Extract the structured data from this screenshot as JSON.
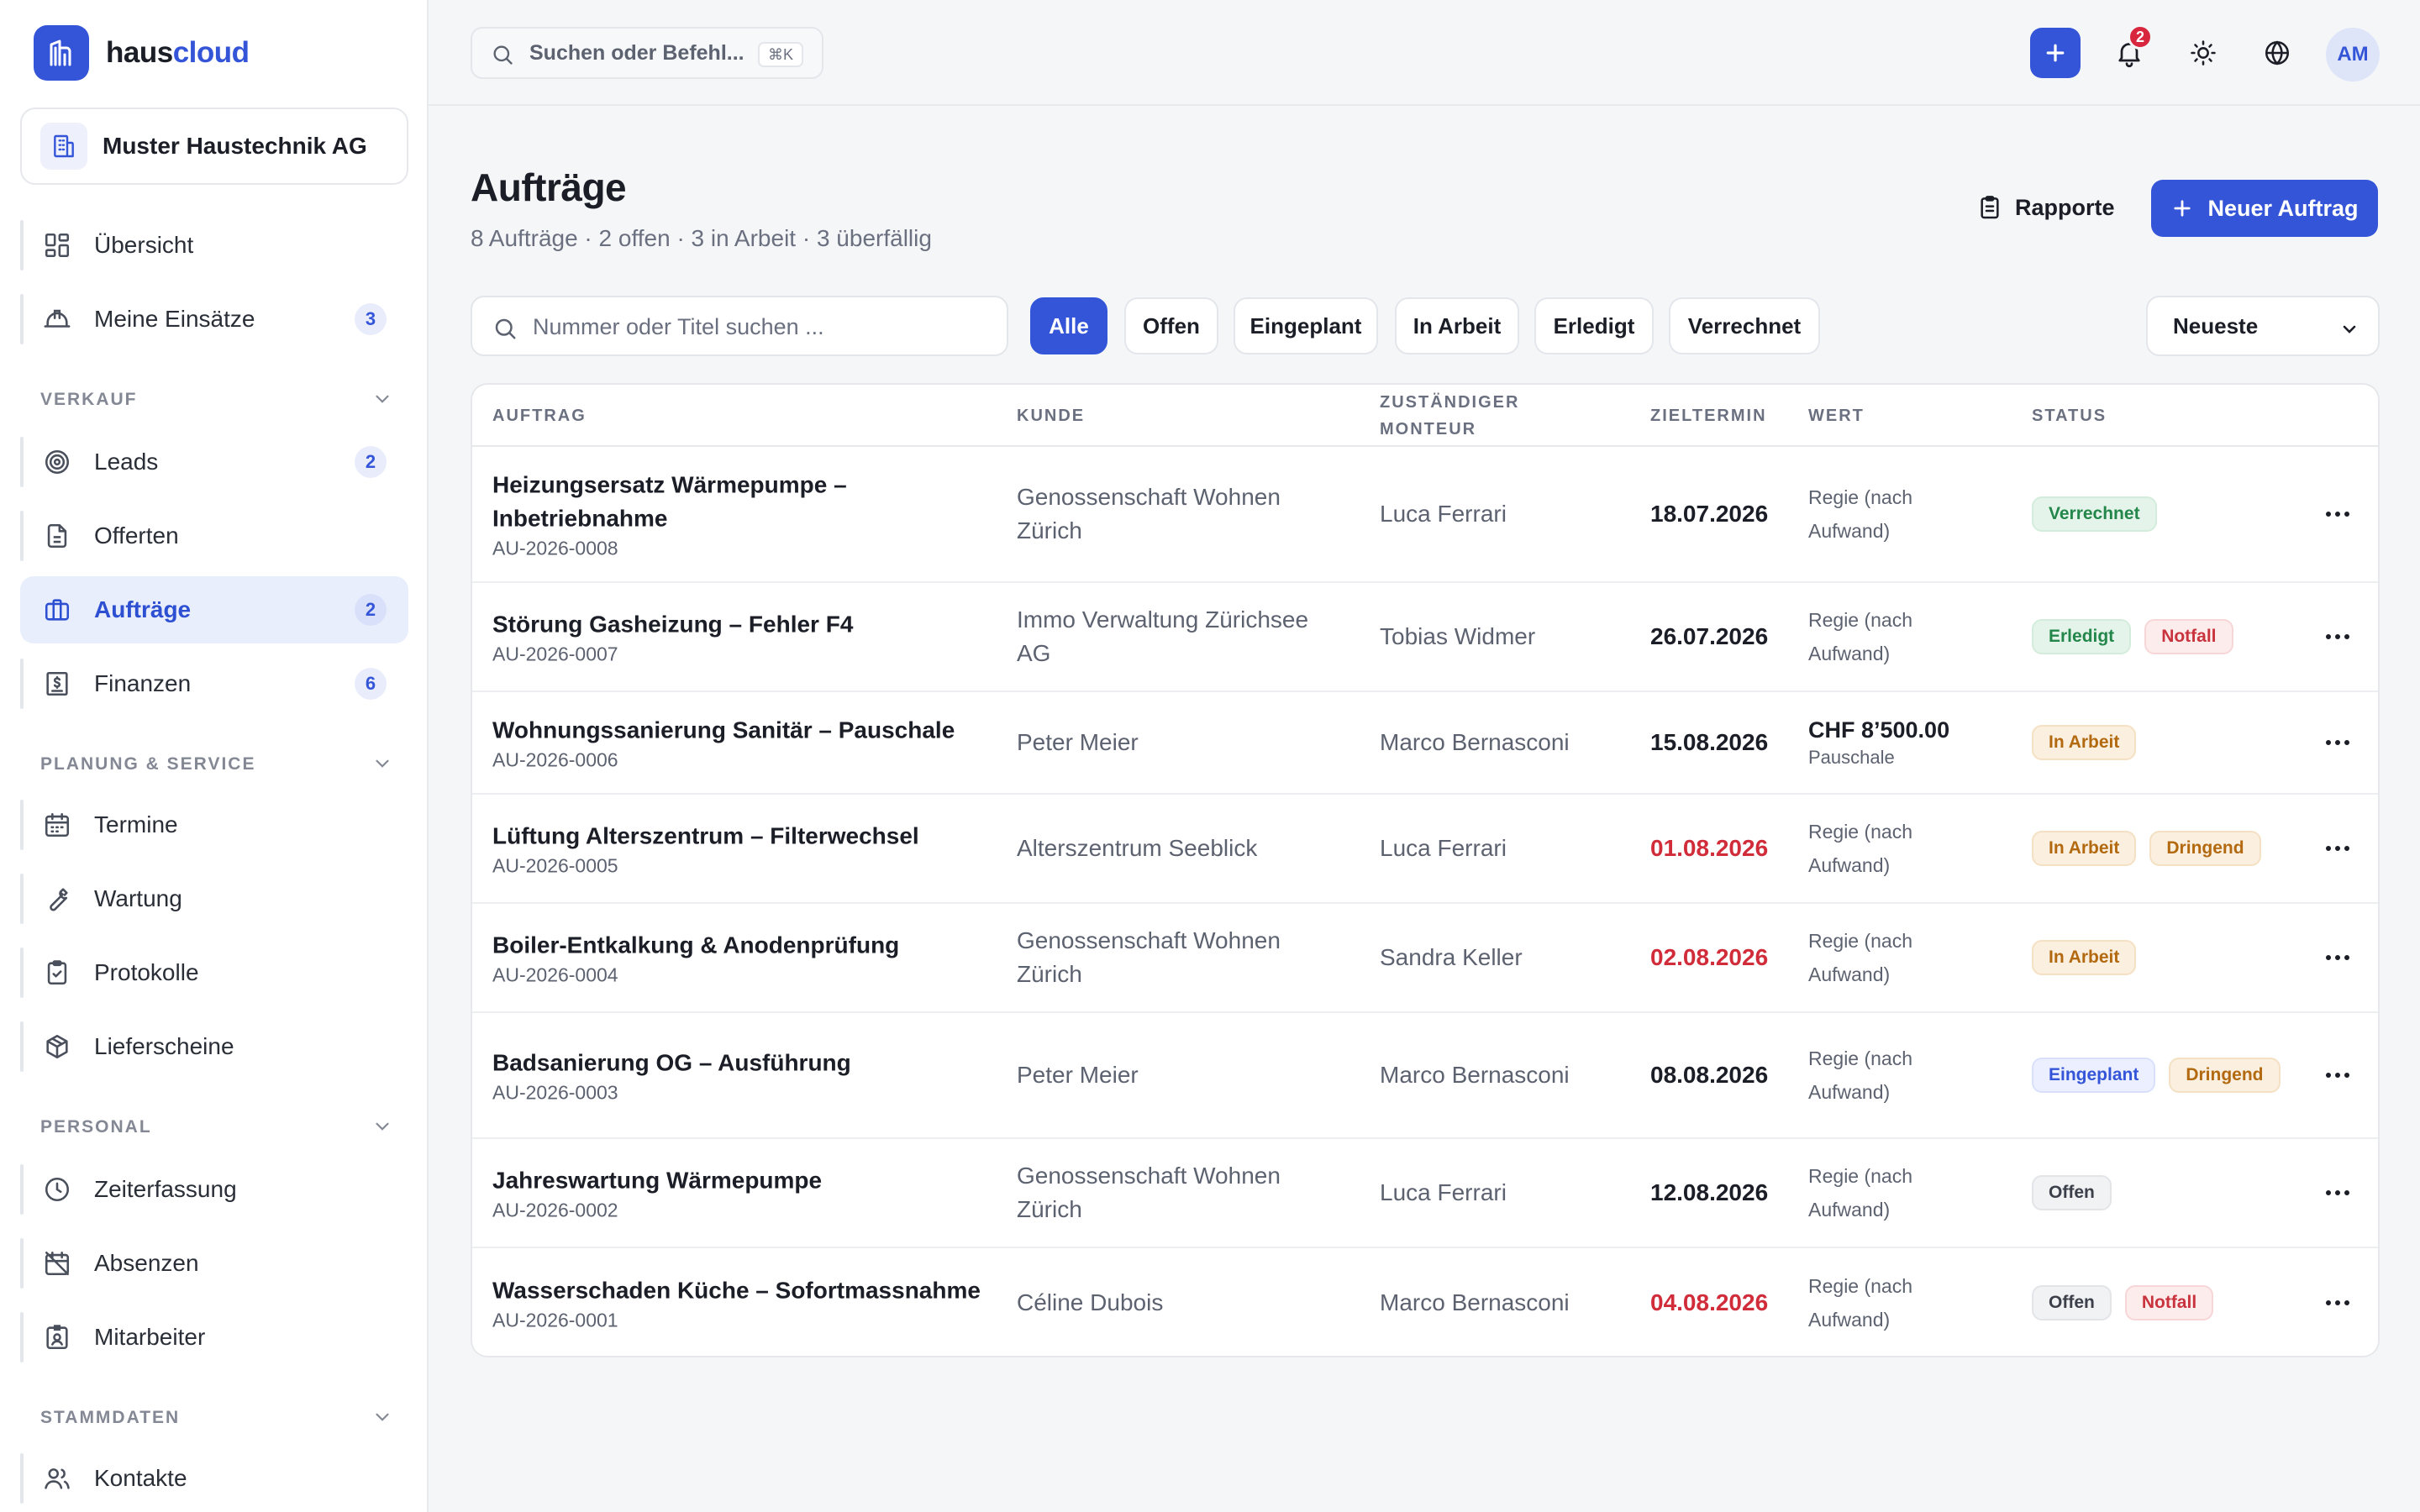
{
  "brand": {
    "part1": "haus",
    "part2": "cloud"
  },
  "company": "Muster Haustechnik AG",
  "nav": {
    "uebersicht": "Übersicht",
    "einsaetze": {
      "label": "Meine Einsätze",
      "count": "3"
    },
    "section_verkauf": "VERKAUF",
    "leads": {
      "label": "Leads",
      "count": "2"
    },
    "offerten": "Offerten",
    "auftraege": {
      "label": "Aufträge",
      "count": "2"
    },
    "finanzen": {
      "label": "Finanzen",
      "count": "6"
    },
    "section_planung": "PLANUNG & SERVICE",
    "termine": "Termine",
    "wartung": "Wartung",
    "protokolle": "Protokolle",
    "lieferscheine": "Lieferscheine",
    "section_personal": "PERSONAL",
    "zeiterfassung": "Zeiterfassung",
    "absenzen": "Absenzen",
    "mitarbeiter": "Mitarbeiter",
    "section_stammdaten": "STAMMDATEN",
    "kontakte": "Kontakte"
  },
  "topbar": {
    "command_placeholder": "Suchen oder Befehl...",
    "shortcut": "⌘K",
    "notifications": "2",
    "avatar": "AM"
  },
  "page": {
    "title": "Aufträge",
    "subtitle": "8 Aufträge · 2 offen · 3 in Arbeit · 3 überfällig",
    "rapporte": "Rapporte",
    "new_order": "Neuer Auftrag"
  },
  "filters": {
    "search_placeholder": "Nummer oder Titel suchen ...",
    "chips": [
      "Alle",
      "Offen",
      "Eingeplant",
      "In Arbeit",
      "Erledigt",
      "Verrechnet"
    ],
    "active_chip": "Alle",
    "sort": "Neueste"
  },
  "table": {
    "headers": {
      "auftrag": "AUFTRAG",
      "kunde": "KUNDE",
      "monteur_1": "ZUSTÄNDIGER",
      "monteur_2": "MONTEUR",
      "zieltermin": "ZIELTERMIN",
      "wert": "WERT",
      "status": "STATUS"
    },
    "rows": [
      {
        "title": "Heizungsersatz Wärmepumpe – Inbetriebnahme",
        "number": "AU-2026-0008",
        "customer": "Genossenschaft Wohnen Zürich",
        "monteur": "Luca Ferrari",
        "date": "18.07.2026",
        "overdue": false,
        "value": "Regie (nach Aufwand)",
        "amount": "",
        "status": [
          {
            "label": "Verrechnet",
            "tone": "green"
          }
        ]
      },
      {
        "title": "Störung Gasheizung – Fehler F4",
        "number": "AU-2026-0007",
        "customer": "Immo Verwaltung Zürichsee AG",
        "monteur": "Tobias Widmer",
        "date": "26.07.2026",
        "overdue": false,
        "value": "Regie (nach Aufwand)",
        "amount": "",
        "status": [
          {
            "label": "Erledigt",
            "tone": "green"
          },
          {
            "label": "Notfall",
            "tone": "red"
          }
        ]
      },
      {
        "title": "Wohnungssanierung Sanitär – Pauschale",
        "number": "AU-2026-0006",
        "customer": "Peter Meier",
        "monteur": "Marco Bernasconi",
        "date": "15.08.2026",
        "overdue": false,
        "value": "Pauschale",
        "amount": "CHF 8’500.00",
        "status": [
          {
            "label": "In Arbeit",
            "tone": "amber"
          }
        ]
      },
      {
        "title": "Lüftung Alterszentrum – Filterwechsel",
        "number": "AU-2026-0005",
        "customer": "Alterszentrum Seeblick",
        "monteur": "Luca Ferrari",
        "date": "01.08.2026",
        "overdue": true,
        "value": "Regie (nach Aufwand)",
        "amount": "",
        "status": [
          {
            "label": "In Arbeit",
            "tone": "amber"
          },
          {
            "label": "Dringend",
            "tone": "amber"
          }
        ]
      },
      {
        "title": "Boiler-Entkalkung & Anodenprüfung",
        "number": "AU-2026-0004",
        "customer": "Genossenschaft Wohnen Zürich",
        "monteur": "Sandra Keller",
        "date": "02.08.2026",
        "overdue": true,
        "value": "Regie (nach Aufwand)",
        "amount": "",
        "status": [
          {
            "label": "In Arbeit",
            "tone": "amber"
          }
        ]
      },
      {
        "title": "Badsanierung OG – Ausführung",
        "number": "AU-2026-0003",
        "customer": "Peter Meier",
        "monteur": "Marco Bernasconi",
        "date": "08.08.2026",
        "overdue": false,
        "value": "Regie (nach Aufwand)",
        "amount": "",
        "status": [
          {
            "label": "Eingeplant",
            "tone": "blue"
          },
          {
            "label": "Dringend",
            "tone": "amber"
          }
        ]
      },
      {
        "title": "Jahreswartung Wärmepumpe",
        "number": "AU-2026-0002",
        "customer": "Genossenschaft Wohnen Zürich",
        "monteur": "Luca Ferrari",
        "date": "12.08.2026",
        "overdue": false,
        "value": "Regie (nach Aufwand)",
        "amount": "",
        "status": [
          {
            "label": "Offen",
            "tone": "gray"
          }
        ]
      },
      {
        "title": "Wasserschaden Küche – Sofortmassnahme",
        "number": "AU-2026-0001",
        "customer": "Céline Dubois",
        "monteur": "Marco Bernasconi",
        "date": "04.08.2026",
        "overdue": true,
        "value": "Regie (nach Aufwand)",
        "amount": "",
        "status": [
          {
            "label": "Offen",
            "tone": "gray"
          },
          {
            "label": "Notfall",
            "tone": "red"
          }
        ]
      }
    ]
  },
  "colors": {
    "accent": "#3455d8",
    "overdue": "#d02c3a",
    "background": "#f5f6f8"
  }
}
